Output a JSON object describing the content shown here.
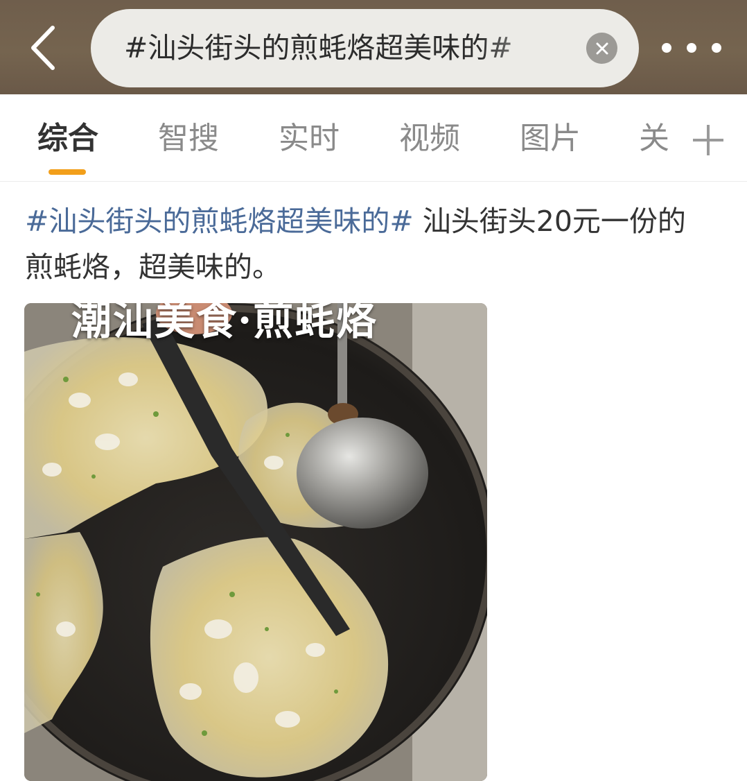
{
  "header": {
    "search_query": "#汕头街头的煎蚝烙超美味的#",
    "back_icon": "chevron-left-icon",
    "clear_icon": "close-icon",
    "more_icon": "more-dots-icon"
  },
  "tabs": [
    {
      "label": "综合",
      "active": true
    },
    {
      "label": "智搜",
      "active": false
    },
    {
      "label": "实时",
      "active": false
    },
    {
      "label": "视频",
      "active": false
    },
    {
      "label": "图片",
      "active": false
    },
    {
      "label": "关",
      "active": false
    }
  ],
  "post": {
    "hashtag": "#汕头街头的煎蚝烙超美味的#",
    "text": " 汕头街头20元一份的煎蚝烙，超美味的。",
    "image": {
      "overlay_caption": "潮汕美食·煎蚝烙",
      "description_icon": "food-photo"
    }
  },
  "colors": {
    "header_bg": "#75644f",
    "accent": "#f29f1b",
    "hashtag": "#4a6a98",
    "text": "#333333",
    "muted": "#8a8a8a"
  }
}
